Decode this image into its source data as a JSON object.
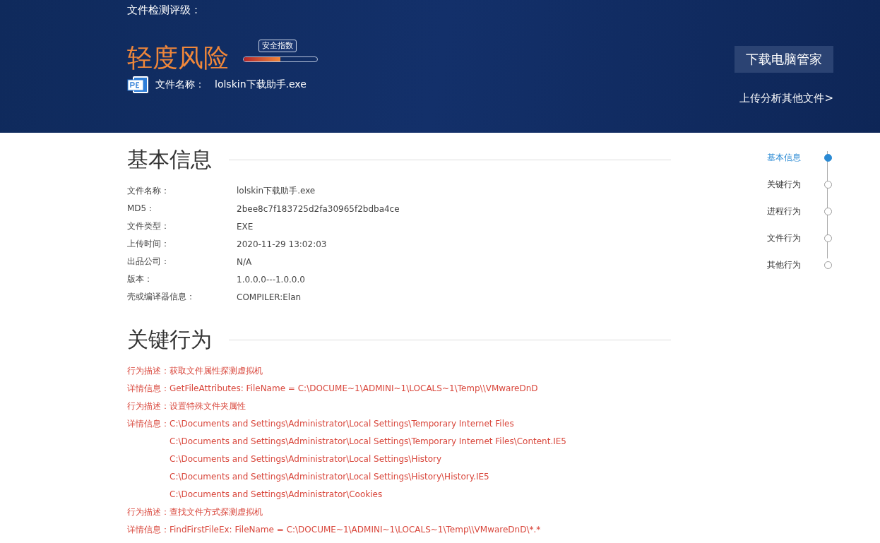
{
  "header": {
    "rating_label": "文件检测评级：",
    "risk": "轻度风险",
    "meter": {
      "tooltip": "安全指数",
      "level": 0.5
    },
    "file_label": "文件名称：",
    "file_name": "lolskin下载助手.exe",
    "download_button": "下载电脑管家",
    "upload_link": "上传分析其他文件>"
  },
  "basic_info": {
    "title": "基本信息",
    "rows": [
      {
        "label": "文件名称：",
        "value": "lolskin下载助手.exe"
      },
      {
        "label": "MD5：",
        "value": "2bee8c7f183725d2fa30965f2bdba4ce"
      },
      {
        "label": "文件类型：",
        "value": "EXE"
      },
      {
        "label": "上传时间：",
        "value": "2020-11-29 13:02:03"
      },
      {
        "label": "出品公司：",
        "value": "N/A"
      },
      {
        "label": "版本：",
        "value": "1.0.0.0---1.0.0.0"
      },
      {
        "label": "壳或编译器信息：",
        "value": "COMPILER:Elan"
      }
    ]
  },
  "key_behaviors": {
    "title": "关键行为",
    "items": [
      {
        "label": "行为描述：",
        "lines": [
          "获取文件属性探测虚拟机"
        ]
      },
      {
        "label": "详情信息：",
        "lines": [
          "GetFileAttributes: FileName = C:\\DOCUME~1\\ADMINI~1\\LOCALS~1\\Temp\\\\VMwareDnD"
        ]
      },
      {
        "label": "行为描述：",
        "lines": [
          "设置特殊文件夹属性"
        ]
      },
      {
        "label": "详情信息：",
        "lines": [
          "C:\\Documents and Settings\\Administrator\\Local Settings\\Temporary Internet Files",
          "C:\\Documents and Settings\\Administrator\\Local Settings\\Temporary Internet Files\\Content.IE5",
          "C:\\Documents and Settings\\Administrator\\Local Settings\\History",
          "C:\\Documents and Settings\\Administrator\\Local Settings\\History\\History.IE5",
          "C:\\Documents and Settings\\Administrator\\Cookies"
        ]
      },
      {
        "label": "行为描述：",
        "lines": [
          "查找文件方式探测虚拟机"
        ]
      },
      {
        "label": "详情信息：",
        "lines": [
          "FindFirstFileEx: FileName = C:\\DOCUME~1\\ADMINI~1\\LOCALS~1\\Temp\\\\VMwareDnD\\*.*"
        ]
      }
    ]
  },
  "side_nav": [
    {
      "label": "基本信息",
      "selected": true
    },
    {
      "label": "关键行为",
      "selected": false
    },
    {
      "label": "进程行为",
      "selected": false
    },
    {
      "label": "文件行为",
      "selected": false
    },
    {
      "label": "其他行为",
      "selected": false
    }
  ]
}
